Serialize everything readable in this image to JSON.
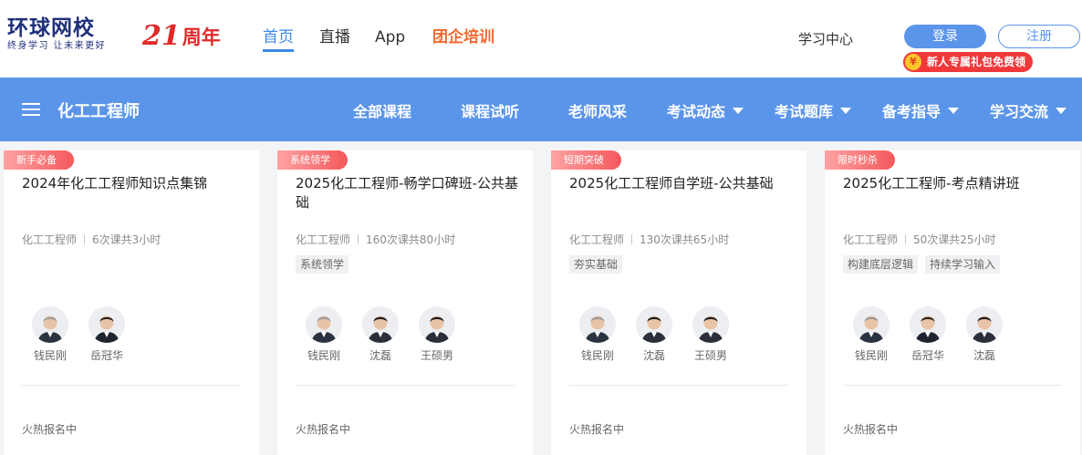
{
  "header": {
    "logo_main": "环球网校",
    "logo_sub": "终身学习 让未来更好",
    "anniversary_num": "21",
    "anniversary_text": "周年",
    "nav": [
      "首页",
      "直播",
      "App",
      "团企培训"
    ],
    "study_center": "学习中心",
    "login": "登录",
    "register": "注册",
    "gift_coin": "¥",
    "gift": "新人专属礼包免费领"
  },
  "navbar": {
    "title": "化工工程师",
    "items": [
      "全部课程",
      "课程试听",
      "老师风采",
      "考试动态",
      "考试题库",
      "备考指导",
      "学习交流"
    ]
  },
  "colors": {
    "brand_blue": "#5b95ea",
    "active_blue": "#3c88e8",
    "orange": "#f26a2e",
    "tag_red": "#f4585b"
  },
  "cards": [
    {
      "tag": "新手必备",
      "title": "2024年化工工程师知识点集锦",
      "category": "化工工程师",
      "lessons": "6次课共3小时",
      "features": [],
      "teachers": [
        "钱民刚",
        "岳冠华"
      ],
      "status": "火热报名中"
    },
    {
      "tag": "系统领学",
      "title": "2025化工工程师-畅学口碑班-公共基础",
      "category": "化工工程师",
      "lessons": "160次课共80小时",
      "features": [
        "系统领学"
      ],
      "teachers": [
        "钱民刚",
        "沈磊",
        "王硕男"
      ],
      "status": "火热报名中"
    },
    {
      "tag": "短期突破",
      "title": "2025化工工程师自学班-公共基础",
      "category": "化工工程师",
      "lessons": "130次课共65小时",
      "features": [
        "夯实基础"
      ],
      "teachers": [
        "钱民刚",
        "沈磊",
        "王硕男"
      ],
      "status": "火热报名中"
    },
    {
      "tag": "限时秒杀",
      "title": "2025化工工程师-考点精讲班",
      "category": "化工工程师",
      "lessons": "50次课共25小时",
      "features": [
        "构建底层逻辑",
        "持续学习输入"
      ],
      "teachers": [
        "钱民刚",
        "岳冠华",
        "沈磊"
      ],
      "status": "火热报名中"
    }
  ]
}
